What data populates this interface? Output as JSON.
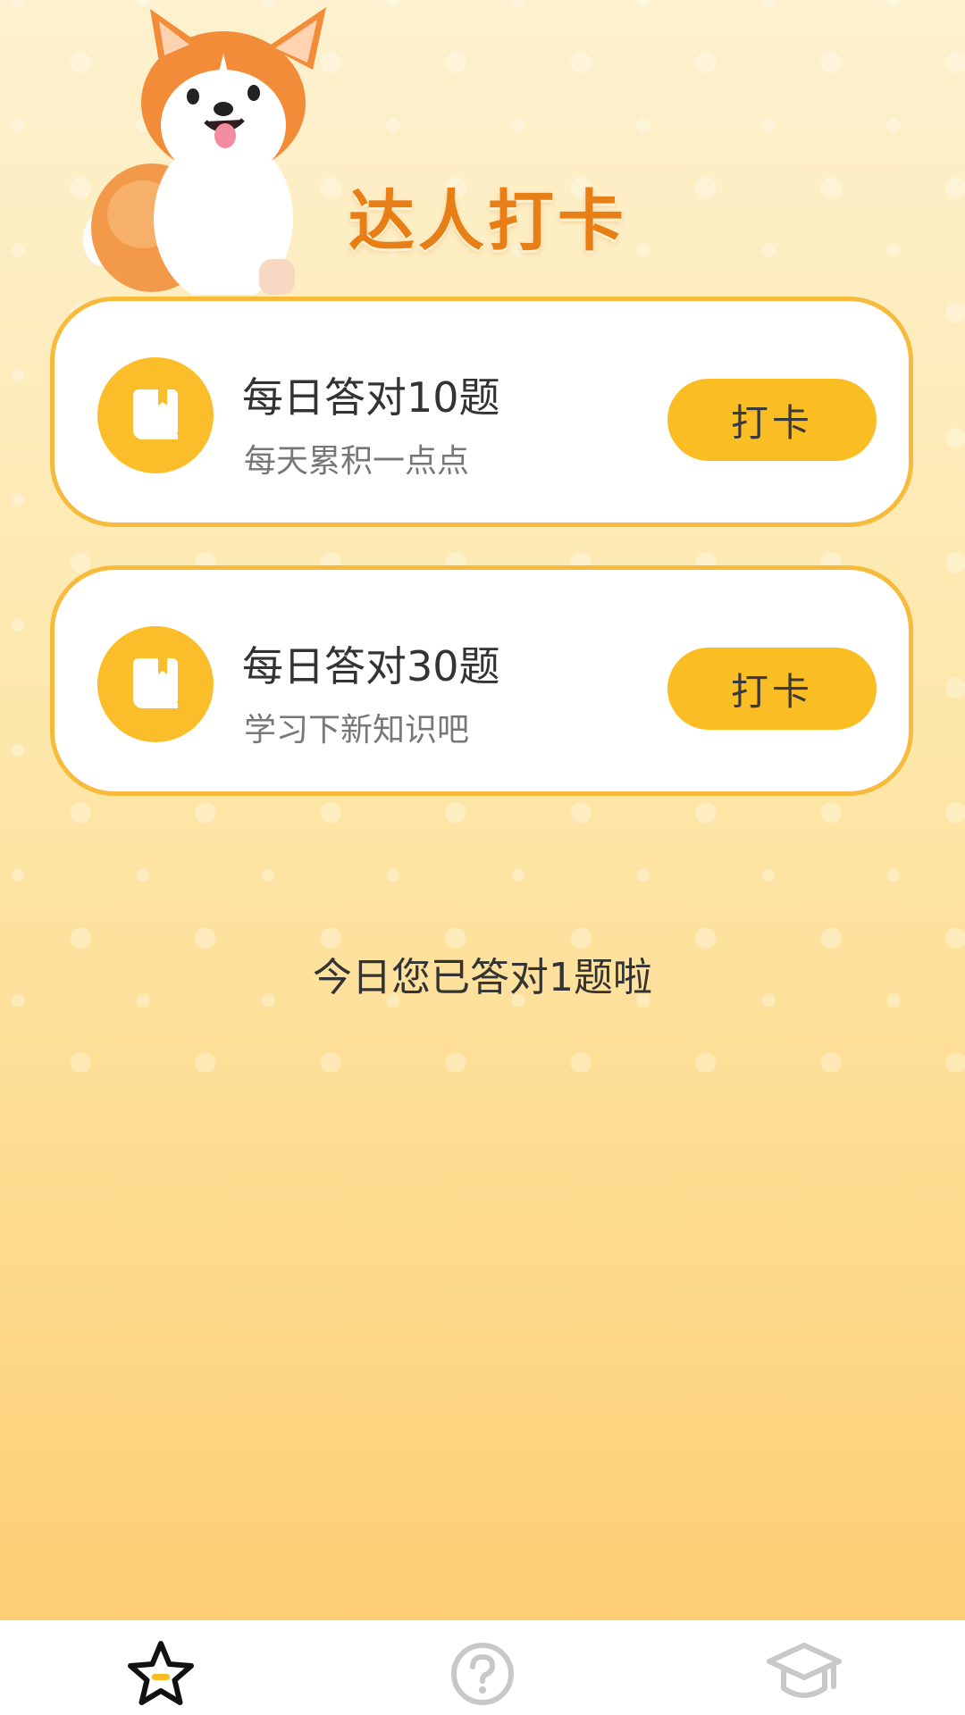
{
  "header": {
    "title": "达人打卡",
    "mascot": "corgi-mascot"
  },
  "tasks": [
    {
      "icon": "book-icon",
      "title": "每日答对10题",
      "subtitle": "每天累积一点点",
      "button_label": "打卡"
    },
    {
      "icon": "book-icon",
      "title": "每日答对30题",
      "subtitle": "学习下新知识吧",
      "button_label": "打卡"
    }
  ],
  "status": {
    "today_text": "今日您已答对1题啦"
  },
  "bottom_nav": {
    "items": [
      {
        "icon": "star-icon",
        "active": true
      },
      {
        "icon": "question-circle-icon",
        "active": false
      },
      {
        "icon": "graduation-cap-icon",
        "active": false
      }
    ]
  },
  "colors": {
    "accent": "#fbbd24",
    "card_border": "#f7ba3a",
    "title_orange": "#e77e16",
    "background_top": "#fdf1cf",
    "background_bottom": "#fdcb6d"
  }
}
